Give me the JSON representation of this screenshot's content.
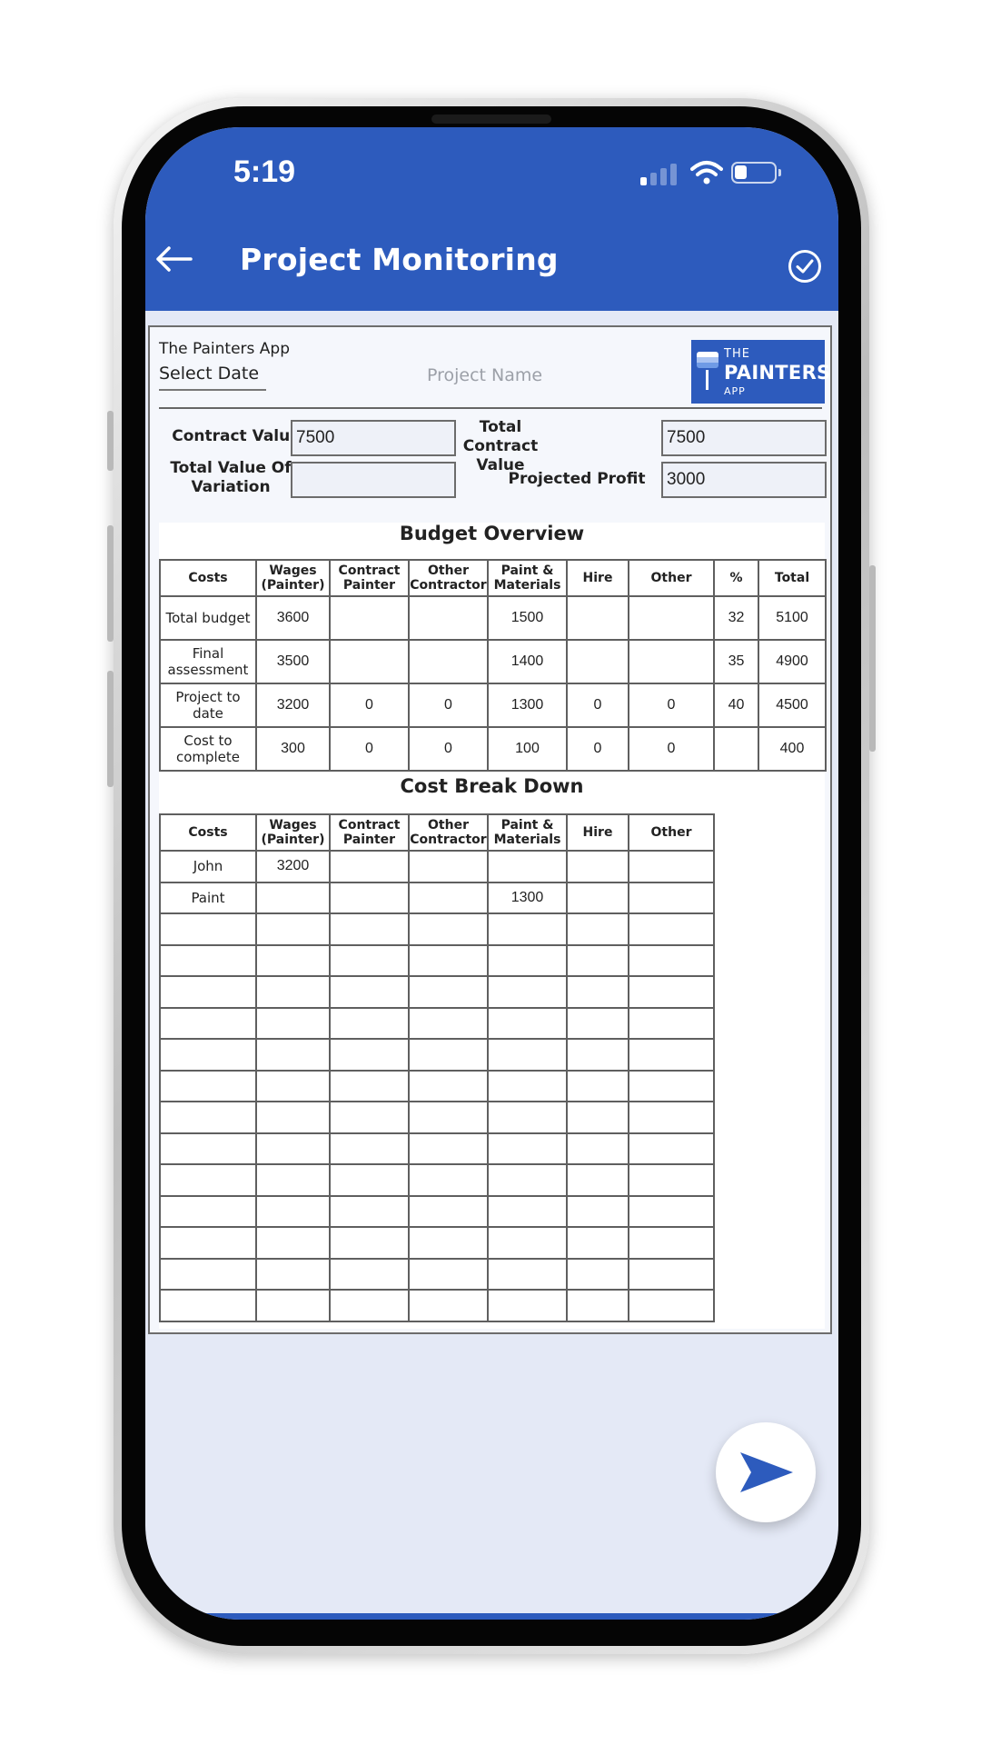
{
  "status_bar": {
    "time": "5:19"
  },
  "header": {
    "title": "Project Monitoring",
    "back_icon": "back-arrow-icon",
    "confirm_icon": "check-circle-icon"
  },
  "document": {
    "app_name": "The Painters App",
    "select_date_label": "Select Date",
    "project_name_placeholder": "Project Name",
    "logo": {
      "line1": "THE",
      "line2": "PAINTERS",
      "line3": "APP"
    },
    "fields": {
      "contract_value_label": "Contract Value",
      "contract_value": "7500",
      "total_contract_value_label": "Total Contract Value",
      "total_contract_value": "7500",
      "total_value_of_variation_label": "Total Value Of Variation",
      "total_value_of_variation": "",
      "projected_profit_label": "Projected Profit",
      "projected_profit": "3000"
    },
    "budget_overview": {
      "title": "Budget Overview",
      "columns": [
        "Costs",
        "Wages (Painter)",
        "Contract Painter",
        "Other Contractor",
        "Paint & Materials",
        "Hire",
        "Other",
        "%",
        "Total"
      ],
      "rows": [
        [
          "Total budget",
          "3600",
          "",
          "",
          "1500",
          "",
          "",
          "32",
          "5100"
        ],
        [
          "Final assessment",
          "3500",
          "",
          "",
          "1400",
          "",
          "",
          "35",
          "4900"
        ],
        [
          "Project to date",
          "3200",
          "0",
          "0",
          "1300",
          "0",
          "0",
          "40",
          "4500"
        ],
        [
          "Cost to complete",
          "300",
          "0",
          "0",
          "100",
          "0",
          "0",
          "",
          "400"
        ]
      ]
    },
    "cost_break_down": {
      "title": "Cost Break Down",
      "columns": [
        "Costs",
        "Wages (Painter)",
        "Contract Painter",
        "Other Contractor",
        "Paint & Materials",
        "Hire",
        "Other"
      ],
      "rows": [
        [
          "John",
          "3200",
          "",
          "",
          "",
          "",
          ""
        ],
        [
          "Paint",
          "",
          "",
          "",
          "1300",
          "",
          ""
        ],
        [
          "",
          "",
          "",
          "",
          "",
          "",
          ""
        ],
        [
          "",
          "",
          "",
          "",
          "",
          "",
          ""
        ],
        [
          "",
          "",
          "",
          "",
          "",
          "",
          ""
        ],
        [
          "",
          "",
          "",
          "",
          "",
          "",
          ""
        ],
        [
          "",
          "",
          "",
          "",
          "",
          "",
          ""
        ],
        [
          "",
          "",
          "",
          "",
          "",
          "",
          ""
        ],
        [
          "",
          "",
          "",
          "",
          "",
          "",
          ""
        ],
        [
          "",
          "",
          "",
          "",
          "",
          "",
          ""
        ],
        [
          "",
          "",
          "",
          "",
          "",
          "",
          ""
        ],
        [
          "",
          "",
          "",
          "",
          "",
          "",
          ""
        ],
        [
          "",
          "",
          "",
          "",
          "",
          "",
          ""
        ],
        [
          "",
          "",
          "",
          "",
          "",
          "",
          ""
        ],
        [
          "",
          "",
          "",
          "",
          "",
          "",
          ""
        ]
      ]
    }
  },
  "fab": {
    "icon": "send-icon"
  },
  "colors": {
    "primary": "#2d5bbd",
    "screen_background": "#e4e9f6"
  }
}
